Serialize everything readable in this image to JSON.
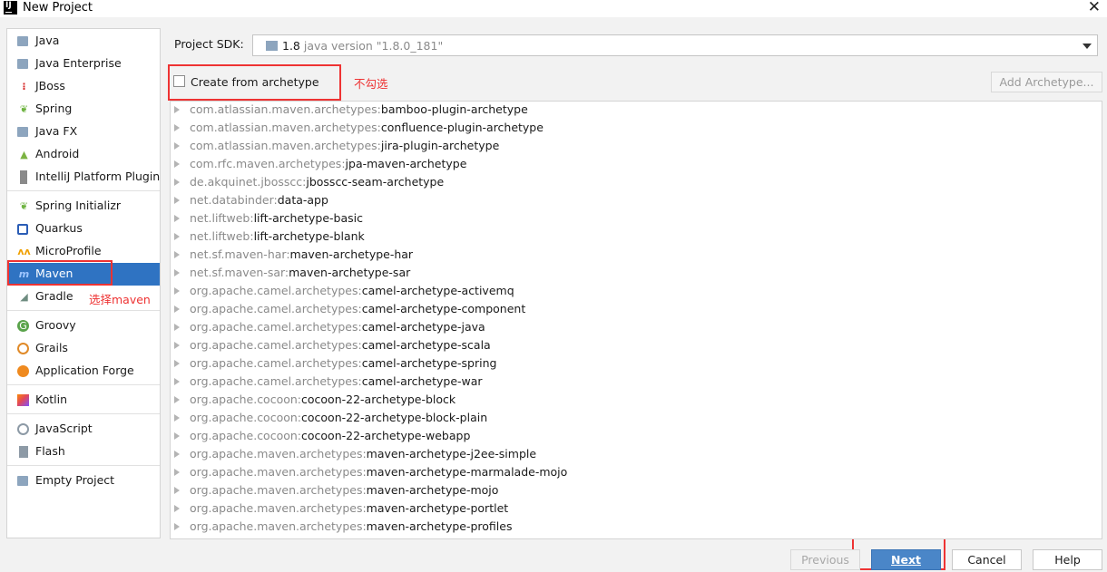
{
  "window": {
    "title": "New Project"
  },
  "sidebar": {
    "items": [
      {
        "label": "Java",
        "icon": "folder-icon"
      },
      {
        "label": "Java Enterprise",
        "icon": "folder-icon"
      },
      {
        "label": "JBoss",
        "icon": "jboss-icon"
      },
      {
        "label": "Spring",
        "icon": "spring-leaf-icon"
      },
      {
        "label": "Java FX",
        "icon": "folder-icon"
      },
      {
        "label": "Android",
        "icon": "android-icon"
      },
      {
        "label": "IntelliJ Platform Plugin",
        "icon": "plugin-icon"
      },
      {
        "label": "Spring Initializr",
        "icon": "spring-initializr-icon"
      },
      {
        "label": "Quarkus",
        "icon": "quarkus-icon"
      },
      {
        "label": "MicroProfile",
        "icon": "microprofile-icon"
      },
      {
        "label": "Maven",
        "icon": "maven-icon",
        "selected": true
      },
      {
        "label": "Gradle",
        "icon": "gradle-elephant-icon"
      },
      {
        "label": "Groovy",
        "icon": "groovy-icon"
      },
      {
        "label": "Grails",
        "icon": "grails-icon"
      },
      {
        "label": "Application Forge",
        "icon": "application-forge-icon"
      },
      {
        "label": "Kotlin",
        "icon": "kotlin-icon"
      },
      {
        "label": "JavaScript",
        "icon": "javascript-globe-icon"
      },
      {
        "label": "Flash",
        "icon": "flash-icon"
      },
      {
        "label": "Empty Project",
        "icon": "folder-icon"
      }
    ]
  },
  "annotations": {
    "maven_note": "选择maven",
    "archetype_note": "不勾选",
    "color": "#e33333"
  },
  "sdk": {
    "label": "Project SDK:",
    "version": "1.8",
    "detail": "java version \"1.8.0_181\""
  },
  "archetype": {
    "checkbox_label": "Create from archetype",
    "checked": false,
    "add_button": "Add Archetype...",
    "items": [
      {
        "group": "com.atlassian.maven.archetypes:",
        "artifact": "bamboo-plugin-archetype"
      },
      {
        "group": "com.atlassian.maven.archetypes:",
        "artifact": "confluence-plugin-archetype"
      },
      {
        "group": "com.atlassian.maven.archetypes:",
        "artifact": "jira-plugin-archetype"
      },
      {
        "group": "com.rfc.maven.archetypes:",
        "artifact": "jpa-maven-archetype"
      },
      {
        "group": "de.akquinet.jbosscc:",
        "artifact": "jbosscc-seam-archetype"
      },
      {
        "group": "net.databinder:",
        "artifact": "data-app"
      },
      {
        "group": "net.liftweb:",
        "artifact": "lift-archetype-basic"
      },
      {
        "group": "net.liftweb:",
        "artifact": "lift-archetype-blank"
      },
      {
        "group": "net.sf.maven-har:",
        "artifact": "maven-archetype-har"
      },
      {
        "group": "net.sf.maven-sar:",
        "artifact": "maven-archetype-sar"
      },
      {
        "group": "org.apache.camel.archetypes:",
        "artifact": "camel-archetype-activemq"
      },
      {
        "group": "org.apache.camel.archetypes:",
        "artifact": "camel-archetype-component"
      },
      {
        "group": "org.apache.camel.archetypes:",
        "artifact": "camel-archetype-java"
      },
      {
        "group": "org.apache.camel.archetypes:",
        "artifact": "camel-archetype-scala"
      },
      {
        "group": "org.apache.camel.archetypes:",
        "artifact": "camel-archetype-spring"
      },
      {
        "group": "org.apache.camel.archetypes:",
        "artifact": "camel-archetype-war"
      },
      {
        "group": "org.apache.cocoon:",
        "artifact": "cocoon-22-archetype-block"
      },
      {
        "group": "org.apache.cocoon:",
        "artifact": "cocoon-22-archetype-block-plain"
      },
      {
        "group": "org.apache.cocoon:",
        "artifact": "cocoon-22-archetype-webapp"
      },
      {
        "group": "org.apache.maven.archetypes:",
        "artifact": "maven-archetype-j2ee-simple"
      },
      {
        "group": "org.apache.maven.archetypes:",
        "artifact": "maven-archetype-marmalade-mojo"
      },
      {
        "group": "org.apache.maven.archetypes:",
        "artifact": "maven-archetype-mojo"
      },
      {
        "group": "org.apache.maven.archetypes:",
        "artifact": "maven-archetype-portlet"
      },
      {
        "group": "org.apache.maven.archetypes:",
        "artifact": "maven-archetype-profiles"
      }
    ]
  },
  "footer": {
    "previous": "Previous",
    "next": "Next",
    "cancel": "Cancel",
    "help": "Help"
  },
  "colors": {
    "selection": "#2f73c2",
    "primary_button": "#4a86c8",
    "annotation": "#e33333"
  }
}
